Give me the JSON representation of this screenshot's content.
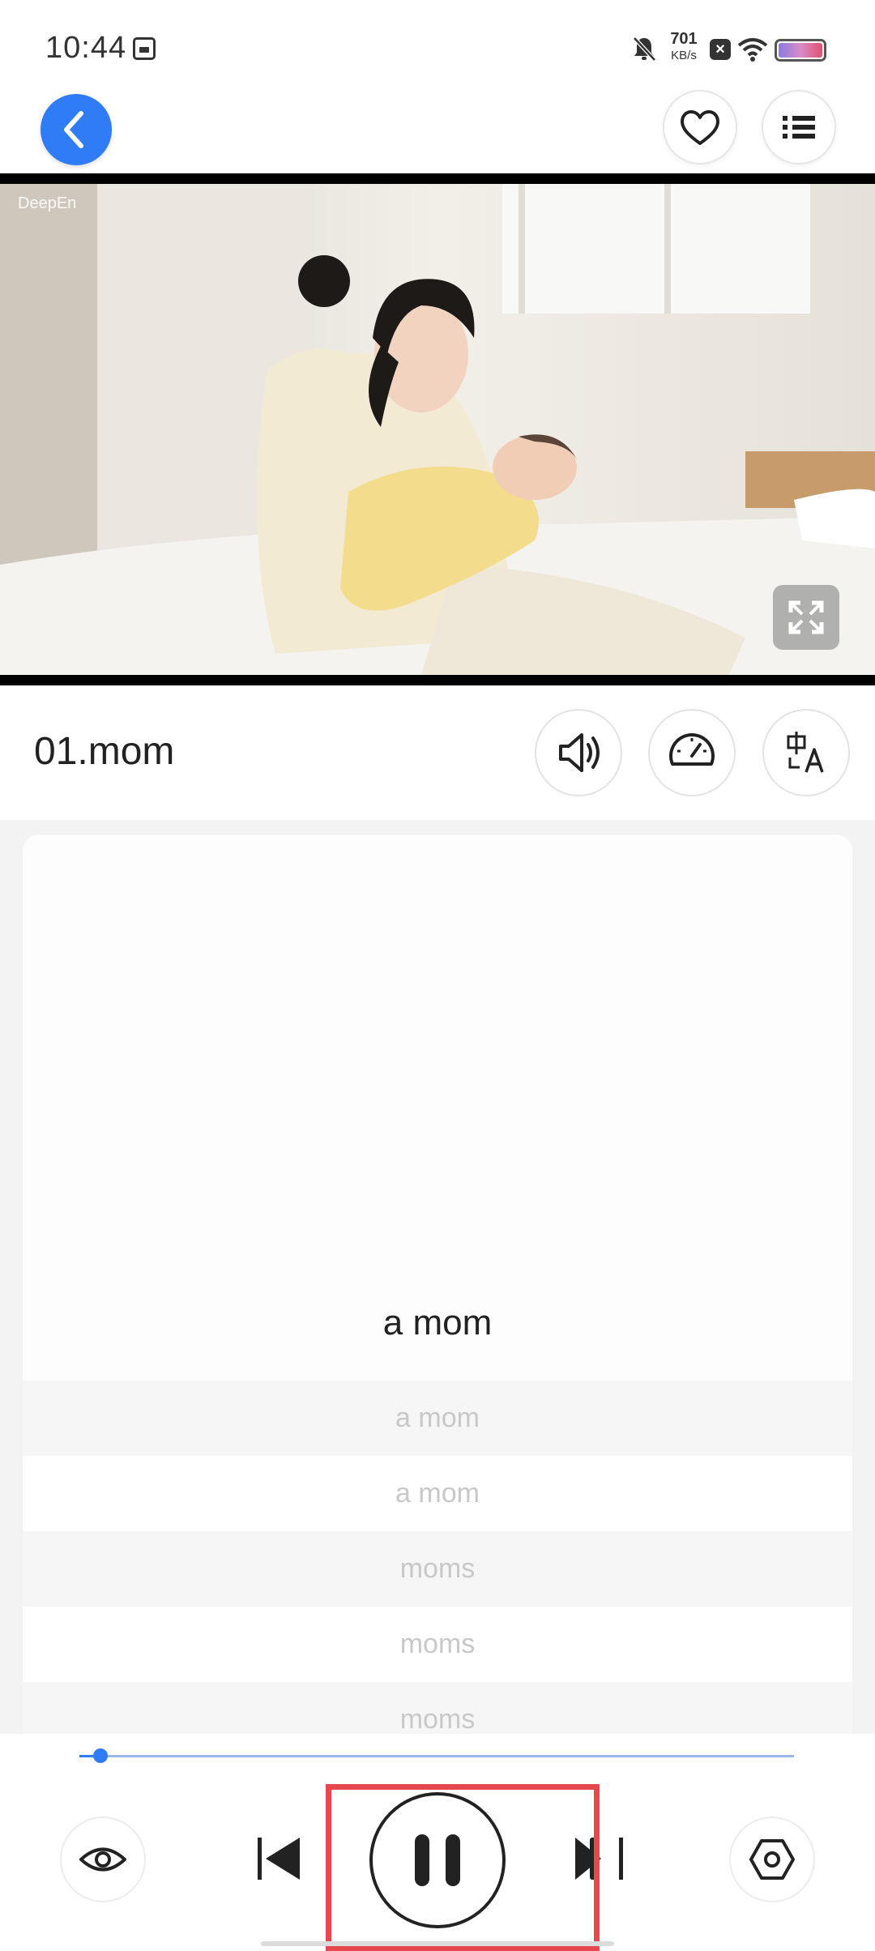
{
  "status_bar": {
    "time": "10:44",
    "net_speed_value": "701",
    "net_speed_unit": "KB/s"
  },
  "header": {
    "back_icon": "chevron-left-icon",
    "favorite_icon": "heart-icon",
    "list_icon": "list-icon",
    "accent_color": "#2f7cf6"
  },
  "video": {
    "watermark": "DeepEn",
    "fullscreen_icon": "expand-icon"
  },
  "track": {
    "title": "01.mom",
    "tools": [
      "speaker-icon",
      "speedometer-icon",
      "translate-icon"
    ]
  },
  "subtitles": {
    "current": "a mom",
    "lines": [
      "a mom",
      "a mom",
      "moms",
      "moms",
      "moms"
    ]
  },
  "player": {
    "progress_fraction": 0.03,
    "controls": [
      "eye-icon",
      "previous-icon",
      "pause-icon",
      "next-icon",
      "settings-icon"
    ],
    "highlight_color": "#e5484d"
  }
}
